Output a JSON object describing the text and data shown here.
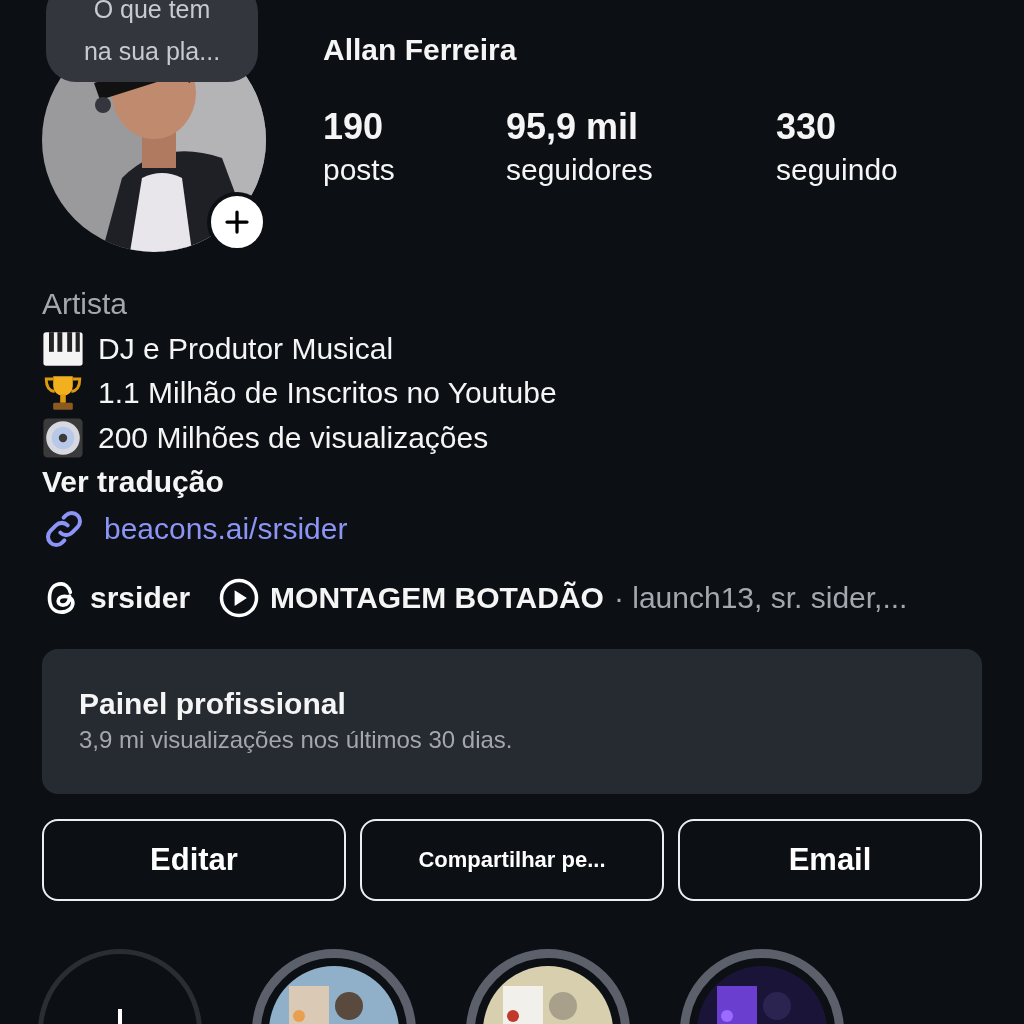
{
  "note_bubble": {
    "text": "O que tem na sua pla..."
  },
  "profile": {
    "name": "Allan Ferreira",
    "avatar": {
      "kind": "picture"
    }
  },
  "stats": [
    {
      "value": "190",
      "label": "posts"
    },
    {
      "value": "95,9 mil",
      "label": "seguidores"
    },
    {
      "value": "330",
      "label": "seguindo"
    }
  ],
  "bio": {
    "category": "Artista",
    "lines": [
      {
        "kind": "piano",
        "text": "DJ e Produtor Musical"
      },
      {
        "kind": "trophy",
        "text": "1.1 Milhão de Inscritos no Youtube"
      },
      {
        "kind": "disc",
        "text": "200 Milhões de visualizações"
      }
    ],
    "translate": "Ver tradução",
    "link": "beacons.ai/srsider"
  },
  "meta_row": {
    "threads": "srsider",
    "music_title": "MONTAGEM BOTADÃO",
    "music_artists": "· launch13, sr. sider,..."
  },
  "dashboard": {
    "title": "Painel profissional",
    "subtitle": "3,9 mi visualizações nos últimos 30 dias."
  },
  "buttons": [
    {
      "label": "Editar",
      "kind": "large"
    },
    {
      "label": "Compartilhar pe...",
      "kind": "small"
    },
    {
      "label": "Email",
      "kind": "large"
    }
  ],
  "highlights": [
    {
      "kind": "new"
    },
    {
      "kind": "picture"
    },
    {
      "kind": "picture"
    },
    {
      "kind": "picture"
    }
  ]
}
